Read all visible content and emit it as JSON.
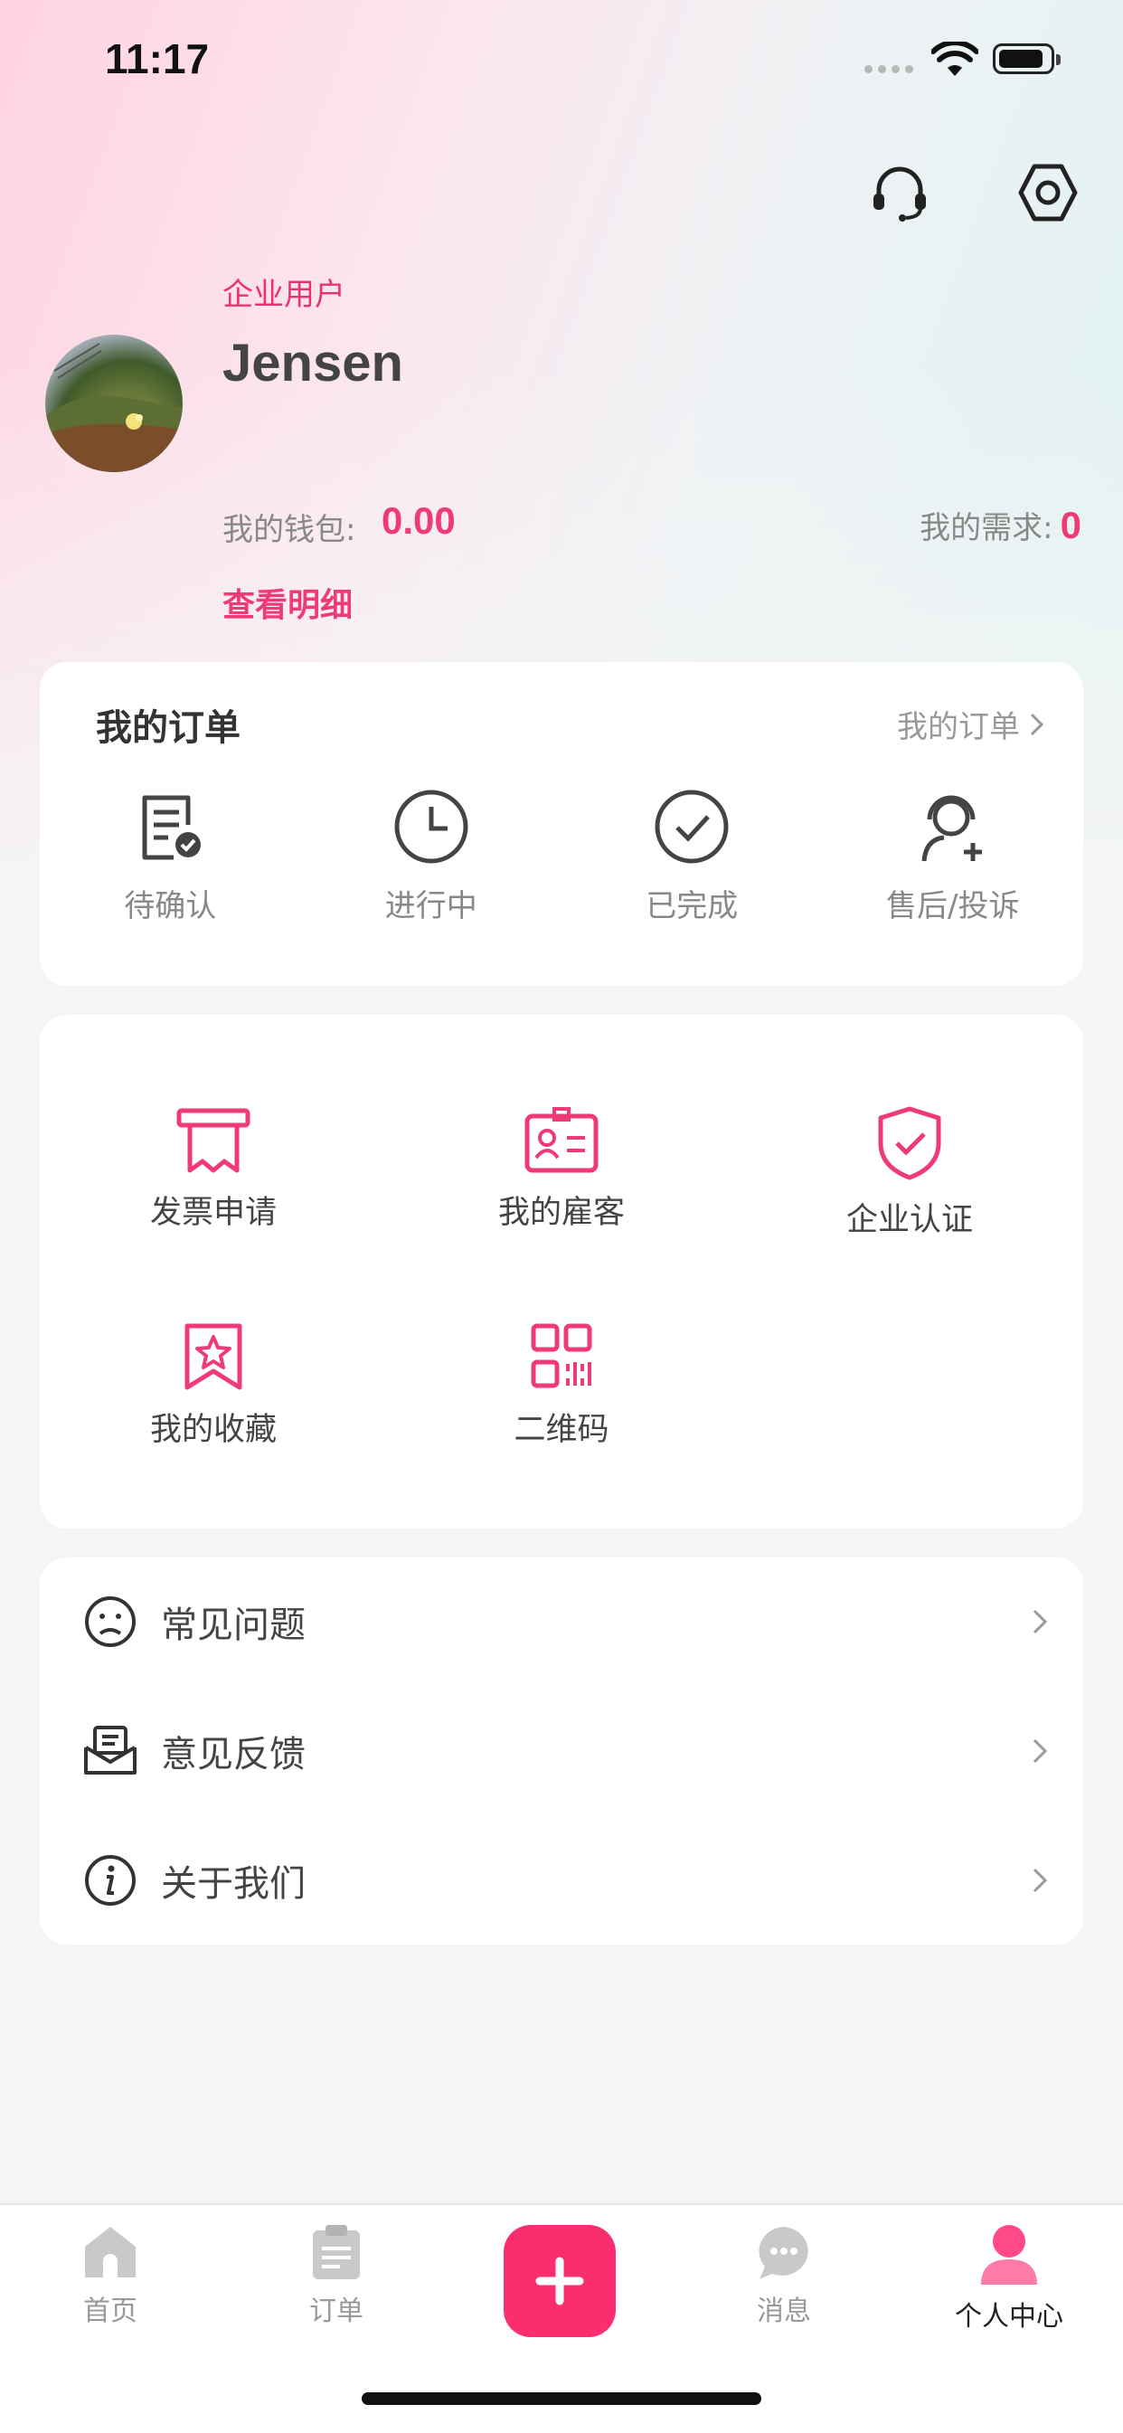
{
  "status_bar": {
    "time": "11:17"
  },
  "header": {
    "support_icon": "headset-icon",
    "settings_icon": "settings-hex-icon"
  },
  "profile": {
    "user_type": "企业用户",
    "name": "Jensen",
    "wallet_label": "我的钱包:",
    "wallet_value": "0.00",
    "demand_label": "我的需求:",
    "demand_value": "0",
    "detail_link": "查看明细"
  },
  "orders": {
    "title": "我的订单",
    "more_label": "我的订单",
    "items": [
      {
        "label": "待确认",
        "icon": "document-check-icon"
      },
      {
        "label": "进行中",
        "icon": "clock-icon"
      },
      {
        "label": "已完成",
        "icon": "check-circle-icon"
      },
      {
        "label": "售后/投诉",
        "icon": "service-agent-icon"
      }
    ]
  },
  "tools": [
    {
      "label": "发票申请",
      "icon": "invoice-icon"
    },
    {
      "label": "我的雇客",
      "icon": "id-card-icon"
    },
    {
      "label": "企业认证",
      "icon": "shield-check-icon"
    },
    {
      "label": "我的收藏",
      "icon": "bookmark-star-icon"
    },
    {
      "label": "二维码",
      "icon": "qr-code-icon"
    }
  ],
  "menu": [
    {
      "label": "常见问题",
      "icon": "sad-face-icon"
    },
    {
      "label": "意见反馈",
      "icon": "feedback-mail-icon"
    },
    {
      "label": "关于我们",
      "icon": "info-icon"
    }
  ],
  "tabbar": {
    "tabs": [
      {
        "label": "首页",
        "icon": "home-icon"
      },
      {
        "label": "订单",
        "icon": "clipboard-icon"
      },
      {
        "label": "消息",
        "icon": "chat-bubble-icon"
      },
      {
        "label": "个人中心",
        "icon": "person-icon"
      }
    ],
    "center_icon": "plus-icon",
    "active": "个人中心"
  },
  "colors": {
    "accent": "#ee3b78",
    "center_button": "#fa2d6e",
    "icon_dark": "#444444"
  }
}
